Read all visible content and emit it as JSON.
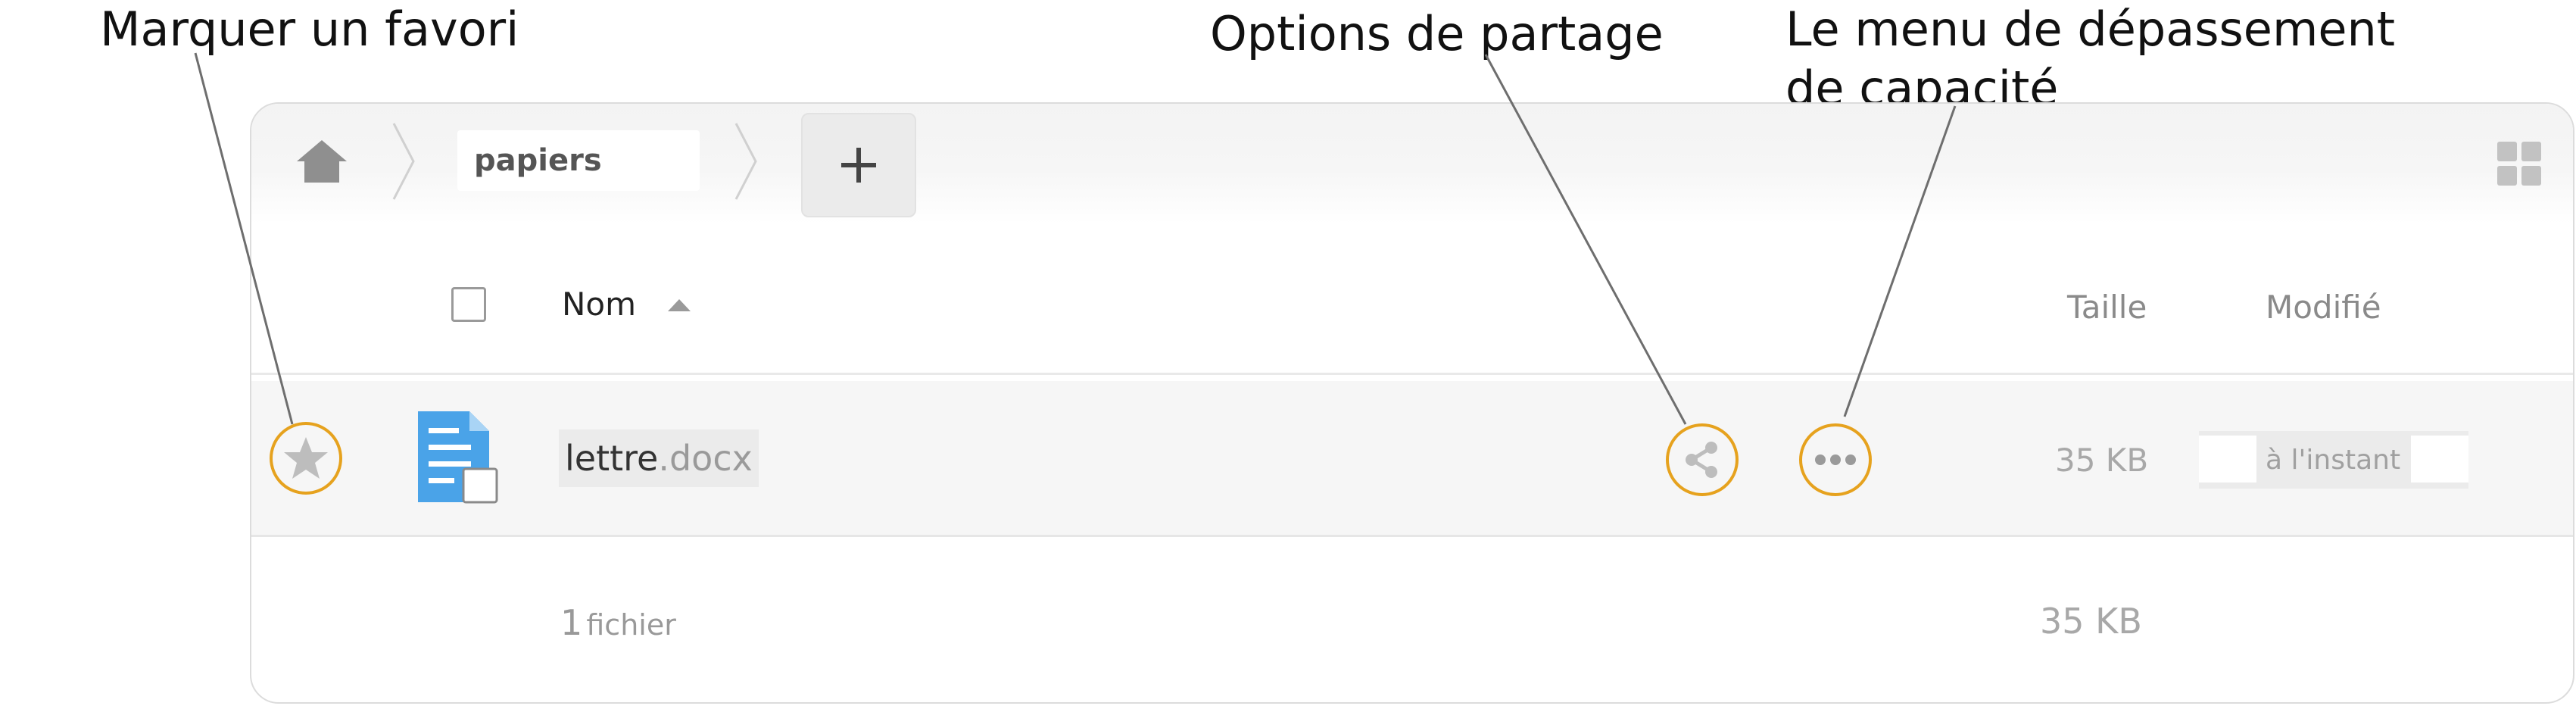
{
  "callouts": {
    "favorite": "Marquer un favori",
    "share": "Options de partage",
    "overflow_line1": "Le menu de dépassement",
    "overflow_line2": "de capacité"
  },
  "breadcrumb": {
    "folder": "papiers",
    "add_label": "+"
  },
  "columns": {
    "name": "Nom",
    "size": "Taille",
    "modified": "Modifié"
  },
  "files": [
    {
      "base": "lettre",
      "ext": ".docx",
      "size": "35 KB",
      "modified": "à l'instant"
    }
  ],
  "summary": {
    "count": "1",
    "count_label": "fichier",
    "total_size": "35 KB"
  },
  "colors": {
    "accent_ring": "#e6a21e",
    "file_icon": "#4aa3e8",
    "row_background": "#f6f6f6"
  },
  "icons": {
    "home": "home-icon",
    "add": "plus-icon",
    "view": "grid-view-icon",
    "favorite": "star-icon",
    "share": "share-icon",
    "more": "more-icon",
    "file": "document-icon"
  }
}
